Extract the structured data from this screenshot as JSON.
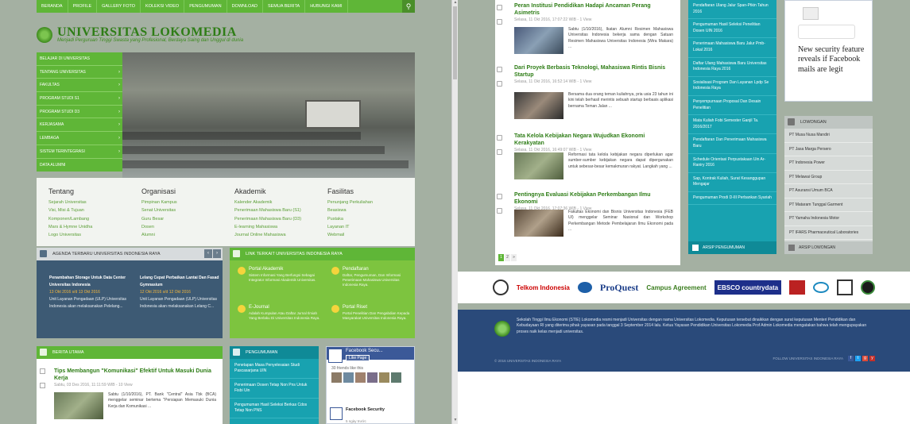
{
  "nav": {
    "items": [
      "BERANDA",
      "PROFILE",
      "GALLERY FOTO",
      "KOLEKSI VIDEO",
      "PENGUMUMAN",
      "DOWNLOAD",
      "SEMUA BERITA",
      "HUBUNGI KAMI"
    ],
    "search_icon": "search-icon"
  },
  "brand": {
    "title": "UNIVERSITAS LOKOMEDIA",
    "subtitle": "Menjadi Perguruan Tinggi Swasta yang Profesional, Berdaya Saing dan Unggul di dunia"
  },
  "sidebar": {
    "items": [
      "BELAJAR DI UNIVERSITAS",
      "TENTANG UNIVERSITAS",
      "FAKULTAS",
      "PROGRAM STUDI S1",
      "PROGRAM STUDI D3",
      "KERJASAMA",
      "LEMBAGA",
      "SISTEM TERINTEGRASI",
      "DATA ALUMNI"
    ],
    "chevron": "›"
  },
  "quicklinks": [
    {
      "heading": "Tentang",
      "links": [
        "Sejarah Universitas",
        "Visi, Misi & Tujuan",
        "Komponen/Lambang",
        "Mars & Hymne Unidha",
        "Logo Universitas"
      ]
    },
    {
      "heading": "Organisasi",
      "links": [
        "Pimpinan Kampus",
        "Senat Universitas",
        "Guru Besar",
        "Dosen",
        "Alumni"
      ]
    },
    {
      "heading": "Akademik",
      "links": [
        "Kalender Akademik",
        "Penerimaan Mahasiswa Baru (S1)",
        "Penerimaan Mahasiswa Baru (D3)",
        "E-learning Mahasiswa",
        "Journal Online Mahasiswa"
      ]
    },
    {
      "heading": "Fasilitas",
      "links": [
        "Penunjang Perkuliahan",
        "Beasiswa",
        "Pustaka",
        "Layanan IT",
        "Webmail"
      ]
    }
  ],
  "agenda": {
    "title": "AGENDA TERBARU UNIVERSITAS INDONESIA RAYA",
    "prev": "‹",
    "next": "›",
    "items": [
      {
        "title": "Penambahan Storage Untuk Data Center Universitas Indonesia",
        "date": "13 Okt 2016 s/d 13 Okt 2016",
        "desc": "Unit Layanan Pengadaan (ULP) Universitas Indonesia akan melaksanakan Pelelang..."
      },
      {
        "title": "Lelang Cepat Perbaikan Lantai Dan Fasad Gymnasium",
        "date": "12 Okt 2016 s/d 12 Okt 2016",
        "desc": "Unit Layanan Pengadaan (ULP) Universitas Indonesia akan melaksanakan Lelang C..."
      }
    ]
  },
  "terkait": {
    "title": "LINK TERKAIT UNIVERSITAS INDONESIA RAYA",
    "items": [
      {
        "title": "Portal Akademik",
        "desc": "Sistem Informasi Yang Berfungsi Sebagai Integrator Informasi Akademik Universitas."
      },
      {
        "title": "Pendaftaran",
        "desc": "Daftar, Pengumuman, Dan Informasi Penerimaan Mahasiswa Universitas Indonesia Raya."
      },
      {
        "title": "E-Journal",
        "desc": "Adalah Kumpulan Atau Daftar Jurnal Ilmiah Yang Berlaku Di Universitas Indonesia Raya."
      },
      {
        "title": "Portal Riset",
        "desc": "Portal Penelitian Dan Pengabdian Kepada Masyarakat Universitas Indonesia Raya."
      }
    ]
  },
  "berita": {
    "title": "BERITA UTAMA",
    "item": {
      "title": "Tips Membangun \"Komunikasi\" Efektif Untuk Masuki Dunia Kerja",
      "meta": "Sabtu, 03 Des 2016, 11:11:59 WIB - 10 View",
      "body": "Sabtu (1/10/2016), PT. Bank \"Central\" Asia Tbk (BCA) menggelar seminar bertema \"Persiapan Memasuki Dunia Kerja dan Komunikasi ..."
    }
  },
  "pengumuman": {
    "title": "PENGUMUMAN",
    "items": [
      "Penetapan Masa Penyelesaian Studi Pascasarjana UIN",
      "Penerimaan Dosen Tetap Non Pns Untuk Fisbi Uin",
      "Pengumuman Hasil Seleksi Berkas Cdos Tetap Non PNS"
    ]
  },
  "facebook": {
    "page_name": "Facebook Secu...",
    "like": "Like Page",
    "friends": "30 friends like this",
    "post_name": "Facebook Security",
    "post_meta": "5 ngày trước",
    "post_text": "New security feature reveals if Facebook mails are legit"
  },
  "right_news": [
    {
      "title": "Peran Institusi Pendidikan Hadapi Ancaman Perang Asimetris",
      "meta": "Selasa, 11 Okt 2016, 17:07:22 WIB - 1 View",
      "body": "Sabtu (1/10/2016), Ikatan Alumni Resimen Mahasiswa Universitas Indonesia bekerja sama dengan Satuan Resimen Mahasiswa Universitas Indonesia (Wira Makara) ..."
    },
    {
      "title": "Dari Proyek Berbasis Teknologi, Mahasiswa Rintis Bisnis Startup",
      "meta": "Selasa, 11 Okt 2016, 16:52:14 WIB - 1 View",
      "body": "Bersama dua orang teman kuliahnya, pria usia 23 tahun ini kini telah berhasil merintis sebuah startup berbasis aplikasi bernama Teman Jalan ..."
    },
    {
      "title": "Tata Kelola Kebijakan Negara Wujudkan Ekonomi Kerakyatan",
      "meta": "Selasa, 11 Okt 2016, 16:49:07 WIB - 1 View",
      "body": "Reformasi tata kelola kebijakan negara diperlukan agar sumber-sumber kebijakan negara dapat dipergunakan untuk sebesar-besar kemakmuran rakyat. Langkah yang ..."
    },
    {
      "title": "Pentingnya Evaluasi Kebijakan Perkembangan Ilmu Ekonomi",
      "meta": "Selasa, 11 Okt 2016, 17:07:36 WIB - 1 View",
      "body": "Fakultas Ekonomi dan Bisnis Universitas Indonesia (FEB UI) menggelar Seminar Nasional dan Workshop Perkembangan Metode Pembelajaran Ilmu Ekonomi pada ..."
    }
  ],
  "pager": [
    "1",
    "2",
    "»"
  ],
  "right_teal": {
    "items": [
      "Pendaftaran Ulang Jalur Span-Ptkin Tahun 2016",
      "Pengumuman Hasil Seleksi Penelitian Dosen UIN 2016",
      "Penerimaan Mahasiswa Baru Jalur Pmb-Lokal 2016",
      "Daftar Ulang Mahasiswa Baru Universitas Indonesia Raya 2016",
      "Sosialisasi Program Dan Layanan Lpdp Se Indonesia Raya",
      "Penyempurnaan Proposal Dan Desain Penelitian",
      "Mata Kuliah Fobi Semester Ganjil Ta. 2016/2017",
      "Pendaftaran Dan Penerimaan Mahasiswa Baru",
      "Schedule Orientasi Perpustakaan Uin Ar-Raniry 2016",
      "Sap, Kontrak Kuliah, Surat Kesanggupan Mengajar",
      "Pengumuman Prodi D-III Perbankan Syariah"
    ],
    "footer": "ARSIP PENGUMUMAN"
  },
  "lowongan": {
    "title": "LOWONGAN",
    "items": [
      "PT Musa Nusa Mandiri",
      "PT Jasa Marga Persero",
      "PT Indonesia Power",
      "PT Melawai Group",
      "PT Asuransi Umum BCA",
      "PT Mataram Tunggal Garment",
      "PT Yamaha Indonesia Motor",
      "PT IFARS Pharmaceutical Laboratories"
    ],
    "footer": "ARSIP LOWONGAN"
  },
  "partners": [
    "Telkom Indonesia",
    "ProQuest",
    "Campus Agreement",
    "EBSCO countrydata"
  ],
  "footer": {
    "text": "Sekolah Tinggi Ilmu Ekonomi (STIE) Lokomedia resmi menjadi Universitas dengan nama Universitas Lokomedia. Keputusan tersebut dinaikkan dengan surat keputusan Menteri Pendidikan dan Kebudayaan RI yang diterima pihak yayasan pada tanggal 3 September 2014 lalu. Ketua Yayasan Pendidikan Universitas Lokomedia Prof Admin Lokomedia mengatakan bahwa telah mengupayakan proses naik kelas menjadi universitas.",
    "copyright": "© 2016 UNIVERSITAS INDONESIA RAYA",
    "follow": "FOLLOW UNIVERSITAS INDONESIA RAYA",
    "social": [
      "f",
      "t",
      "g",
      "y"
    ]
  }
}
